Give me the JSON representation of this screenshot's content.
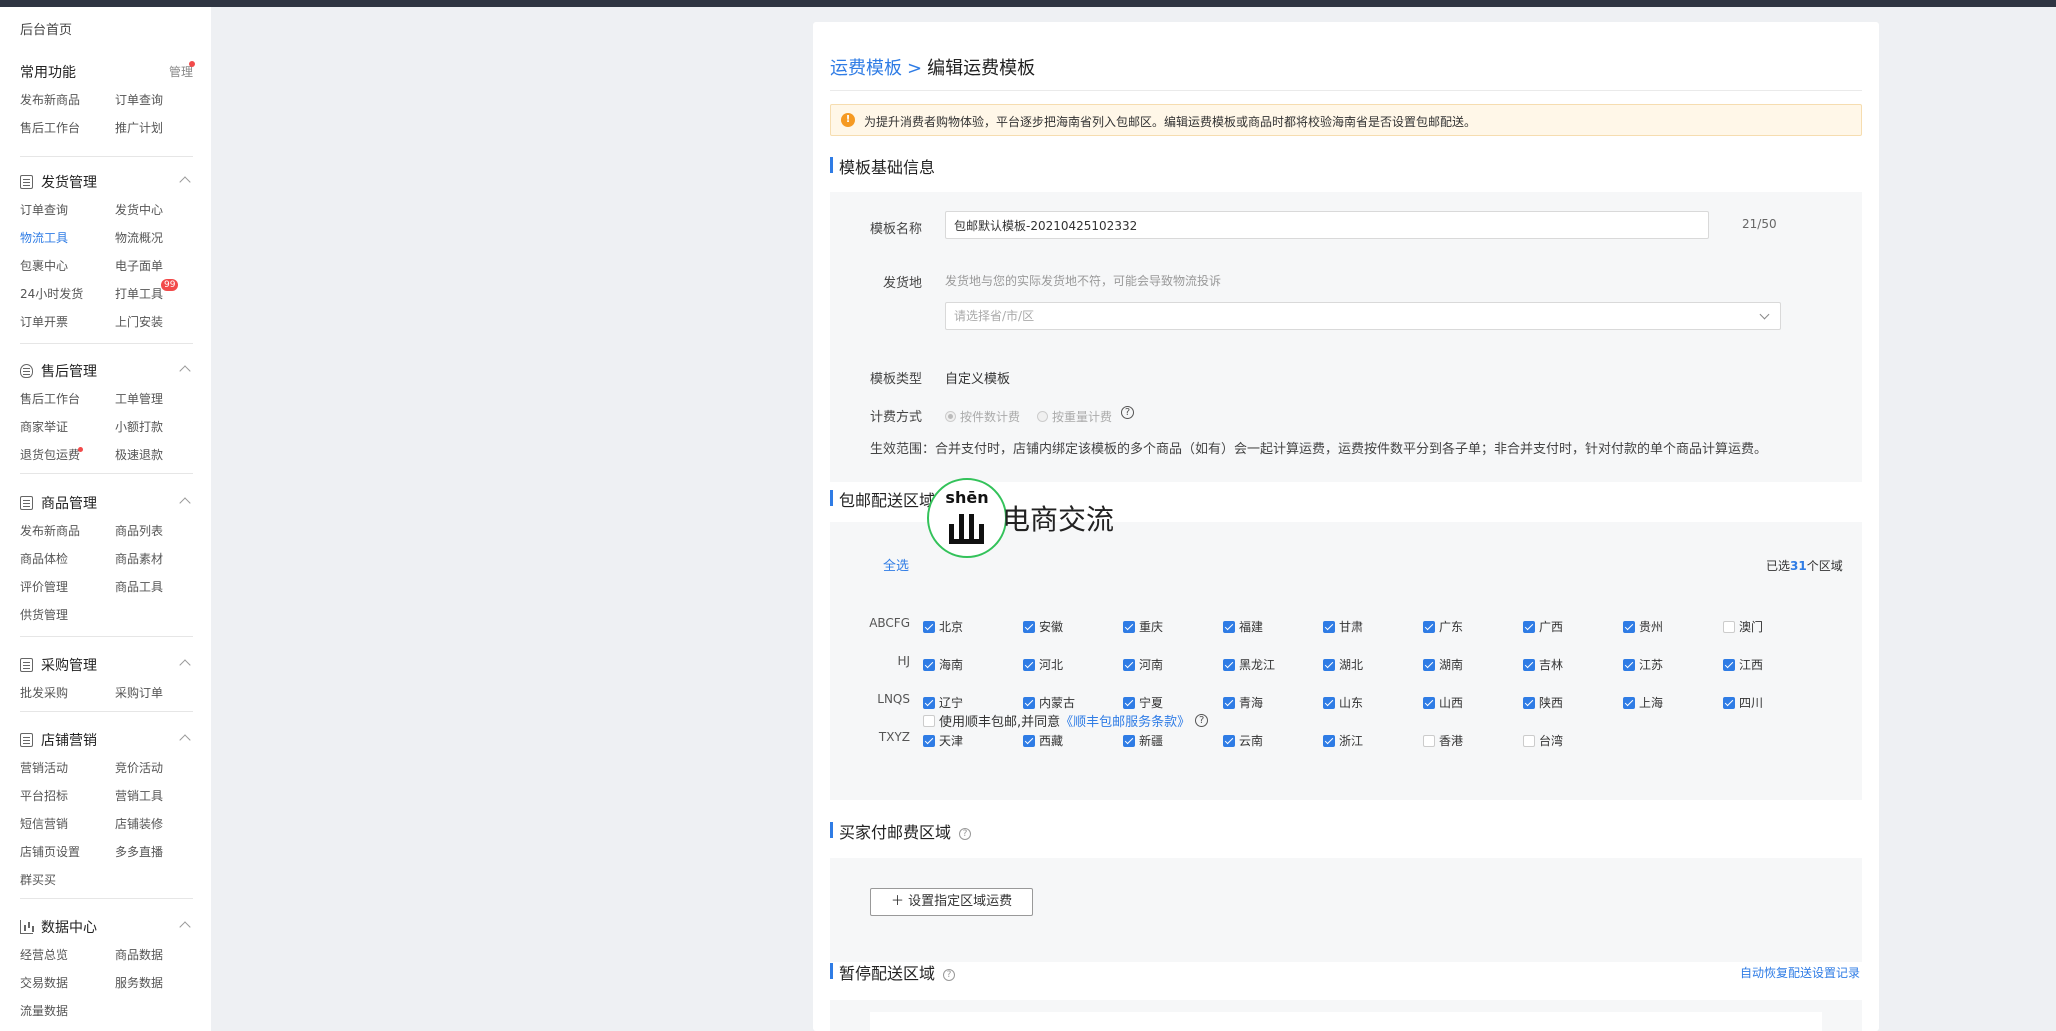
{
  "sidebar": {
    "home": "后台首页",
    "common": {
      "title": "常用功能",
      "manage": "管理",
      "items": [
        "发布新商品",
        "订单查询",
        "售后工作台",
        "推广计划"
      ]
    },
    "groups": [
      {
        "title": "发货管理",
        "items": [
          "订单查询",
          "发货中心",
          "物流工具",
          "物流概况",
          "包裹中心",
          "电子面单",
          "24小时发货",
          "打单工具",
          "订单开票",
          "上门安装"
        ],
        "badge": "99"
      },
      {
        "title": "售后管理",
        "items": [
          "售后工作台",
          "工单管理",
          "商家举证",
          "小额打款",
          "退货包运费",
          "极速退款"
        ]
      },
      {
        "title": "商品管理",
        "items": [
          "发布新商品",
          "商品列表",
          "商品体检",
          "商品素材",
          "评价管理",
          "商品工具",
          "供货管理"
        ]
      },
      {
        "title": "采购管理",
        "items": [
          "批发采购",
          "采购订单"
        ]
      },
      {
        "title": "店铺营销",
        "items": [
          "营销活动",
          "竞价活动",
          "平台招标",
          "营销工具",
          "短信营销",
          "店铺装修",
          "店铺页设置",
          "多多直播",
          "群买买"
        ]
      },
      {
        "title": "数据中心",
        "items": [
          "经营总览",
          "商品数据",
          "交易数据",
          "服务数据",
          "流量数据"
        ]
      }
    ],
    "active_item": "物流工具"
  },
  "breadcrumb": {
    "parent": "运费模板",
    "separator": ">",
    "current": "编辑运费模板"
  },
  "notice": "为提升消费者购物体验，平台逐步把海南省列入包邮区。编辑运费模板或商品时都将校验海南省是否设置包邮配送。",
  "basic": {
    "section_title": "模板基础信息",
    "name_label": "模板名称",
    "name_value": "包邮默认模板-20210425102332",
    "name_count": "21/50",
    "origin_label": "发货地",
    "origin_hint": "发货地与您的实际发货地不符，可能会导致物流投诉",
    "origin_placeholder": "请选择省/市/区",
    "type_label": "模板类型",
    "type_value": "自定义模板",
    "billing_label": "计费方式",
    "billing_options": [
      "按件数计费",
      "按重量计费"
    ],
    "scope": "生效范围：合并支付时，店铺内绑定该模板的多个商品（如有）会一起计算运费，运费按件数平分到各子单；非合并支付时，针对付款的单个商品计算运费。"
  },
  "free_area": {
    "section_title": "包邮配送区域",
    "select_all": "全选",
    "count_prefix": "已选",
    "count": "31",
    "count_suffix": "个区域",
    "rows": [
      {
        "label": "ABCFG",
        "provinces": [
          {
            "name": "北京",
            "checked": true
          },
          {
            "name": "安徽",
            "checked": true
          },
          {
            "name": "重庆",
            "checked": true
          },
          {
            "name": "福建",
            "checked": true
          },
          {
            "name": "甘肃",
            "checked": true
          },
          {
            "name": "广东",
            "checked": true
          },
          {
            "name": "广西",
            "checked": true
          },
          {
            "name": "贵州",
            "checked": true
          },
          {
            "name": "澳门",
            "checked": false
          }
        ]
      },
      {
        "label": "HJ",
        "provinces": [
          {
            "name": "海南",
            "checked": true
          },
          {
            "name": "河北",
            "checked": true
          },
          {
            "name": "河南",
            "checked": true
          },
          {
            "name": "黑龙江",
            "checked": true
          },
          {
            "name": "湖北",
            "checked": true
          },
          {
            "name": "湖南",
            "checked": true
          },
          {
            "name": "吉林",
            "checked": true
          },
          {
            "name": "江苏",
            "checked": true
          },
          {
            "name": "江西",
            "checked": true
          }
        ]
      },
      {
        "label": "LNQS",
        "provinces": [
          {
            "name": "辽宁",
            "checked": true
          },
          {
            "name": "内蒙古",
            "checked": true
          },
          {
            "name": "宁夏",
            "checked": true
          },
          {
            "name": "青海",
            "checked": true
          },
          {
            "name": "山东",
            "checked": true
          },
          {
            "name": "山西",
            "checked": true
          },
          {
            "name": "陕西",
            "checked": true
          },
          {
            "name": "上海",
            "checked": true
          },
          {
            "name": "四川",
            "checked": true
          }
        ]
      },
      {
        "label": "TXYZ",
        "provinces": [
          {
            "name": "天津",
            "checked": true
          },
          {
            "name": "西藏",
            "checked": true
          },
          {
            "name": "新疆",
            "checked": true
          },
          {
            "name": "云南",
            "checked": true
          },
          {
            "name": "浙江",
            "checked": true
          },
          {
            "name": "香港",
            "checked": false
          },
          {
            "name": "台湾",
            "checked": false
          }
        ]
      }
    ],
    "sf_text": "使用顺丰包邮,并同意",
    "sf_link": "《顺丰包邮服务条款》"
  },
  "paid_area": {
    "section_title": "买家付邮费区域",
    "button": "＋ 设置指定区域运费"
  },
  "suspend_area": {
    "section_title": "暂停配送区域",
    "link": "自动恢复配送设置记录"
  },
  "watermark": {
    "pinyin": "shēn",
    "text": "电商交流"
  }
}
